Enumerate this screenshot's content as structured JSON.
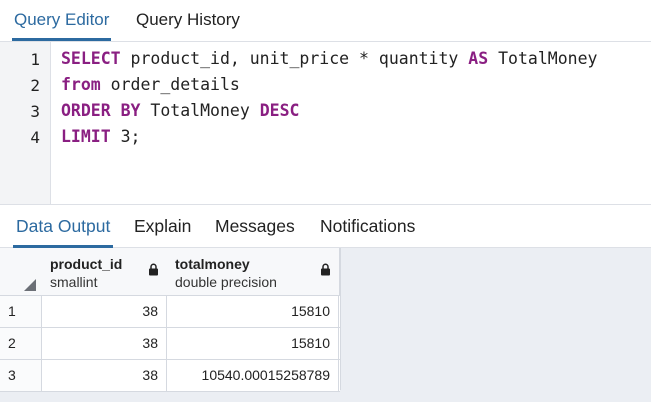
{
  "editor_tabs": [
    "Query Editor",
    "Query History"
  ],
  "code": {
    "line_numbers": [
      "1",
      "2",
      "3",
      "4"
    ],
    "lines": [
      {
        "kw1": "SELECT",
        "t1": " product_id, unit_price * quantity ",
        "kw2": "AS",
        "t2": " TotalMoney"
      },
      {
        "kw1": "from",
        "t1": " order_details"
      },
      {
        "kw1": "ORDER BY",
        "t1": " TotalMoney ",
        "kw2": "DESC"
      },
      {
        "kw1": "LIMIT",
        "t1": " 3;"
      }
    ]
  },
  "output_tabs": [
    "Data Output",
    "Explain",
    "Messages",
    "Notifications"
  ],
  "grid": {
    "columns": [
      {
        "name": "product_id",
        "type": "smallint"
      },
      {
        "name": "totalmoney",
        "type": "double precision"
      }
    ],
    "rows": [
      {
        "num": "1",
        "product_id": "38",
        "totalmoney": "15810"
      },
      {
        "num": "2",
        "product_id": "38",
        "totalmoney": "15810"
      },
      {
        "num": "3",
        "product_id": "38",
        "totalmoney": "10540.00015258789"
      }
    ]
  },
  "colors": {
    "accent": "#2c6aa0",
    "keyword": "#8a1f82"
  },
  "icons": [
    "lock-icon",
    "sort-corner-icon"
  ]
}
